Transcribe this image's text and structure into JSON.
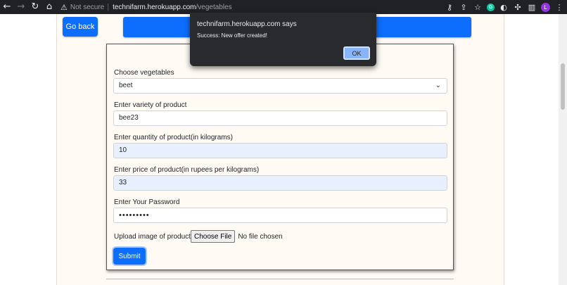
{
  "browser": {
    "security_label": "Not secure",
    "url_host": "technifarm.herokuapp.com",
    "url_path": "/vegetables",
    "profile_initial": "L"
  },
  "page": {
    "go_back_label": "Go back"
  },
  "form": {
    "vegetable_label": "Choose vegetables",
    "vegetable_value": "beet",
    "variety_label": "Enter variety of product",
    "variety_value": "bee23",
    "quantity_label": "Enter quantity of product(in kilograms)",
    "quantity_value": "10",
    "price_label": "Enter price of product(in rupees per kilograms)",
    "price_value": "33",
    "password_label": "Enter Your Password",
    "password_value": "•••••••••",
    "upload_label": "Upload image of product",
    "choose_file_label": "Choose File",
    "no_file_label": "No file chosen",
    "submit_label": "Submit"
  },
  "dialog": {
    "title": "technifarm.herokuapp.com says",
    "message": "Success: New offer created!",
    "ok_label": "OK"
  },
  "colors": {
    "primary": "#0d6efd",
    "chrome": "#202124",
    "dialog_bg": "#292a2d",
    "ok_button": "#8ab4f8",
    "autofill": "#e8f0fe"
  }
}
